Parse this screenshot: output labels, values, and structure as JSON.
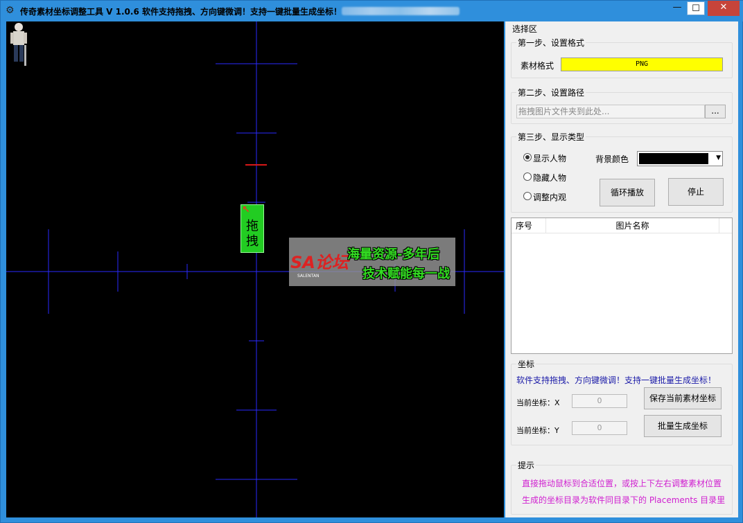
{
  "window": {
    "title": "传奇素材坐标调整工具 V 1.0.6  软件支持拖拽、方向键微调！支持一键批量生成坐标！",
    "app_icon": "gear-icon",
    "minimize_label": "—",
    "maximize_label": "☐",
    "close_label": "✕"
  },
  "canvas": {
    "background_color": "#000000",
    "grid_color": "#2a2aff",
    "drag_label_top": "拖",
    "drag_label_bottom": "拽",
    "watermark": {
      "logo": "SA论坛",
      "logo_sub": "SALENTAN",
      "line1": "海量资源-多年后",
      "line2": "技术赋能每一战"
    }
  },
  "panel": {
    "title": "选择区",
    "step1": {
      "title": "第一步、设置格式",
      "label": "素材格式",
      "value": "PNG"
    },
    "step2": {
      "title": "第二步、设置路径",
      "placeholder": "拖拽图片文件夹到此处...",
      "browse_label": "..."
    },
    "step3": {
      "title": "第三步、显示类型",
      "radios": [
        "显示人物",
        "隐藏人物",
        "调整内观"
      ],
      "selected_index": 0,
      "bg_color_label": "背景颜色",
      "bg_color_value": "#000000",
      "loop_button": "循环播放",
      "stop_button": "停止"
    },
    "list": {
      "col_seq": "序号",
      "col_name": "图片名称"
    },
    "coords": {
      "title": "坐标",
      "note": "软件支持拖拽、方向键微调！支持一键批量生成坐标！",
      "x_label": "当前坐标：X",
      "x_value": "0",
      "y_label": "当前坐标：Y",
      "y_value": "0",
      "save_button": "保存当前素材坐标",
      "batch_button": "批量生成坐标"
    },
    "hints": {
      "title": "提示",
      "line1": "直接拖动鼠标到合适位置，或按上下左右调整素材位置",
      "line2": "生成的坐标目录为软件同目录下的 Placements 目录里"
    }
  }
}
